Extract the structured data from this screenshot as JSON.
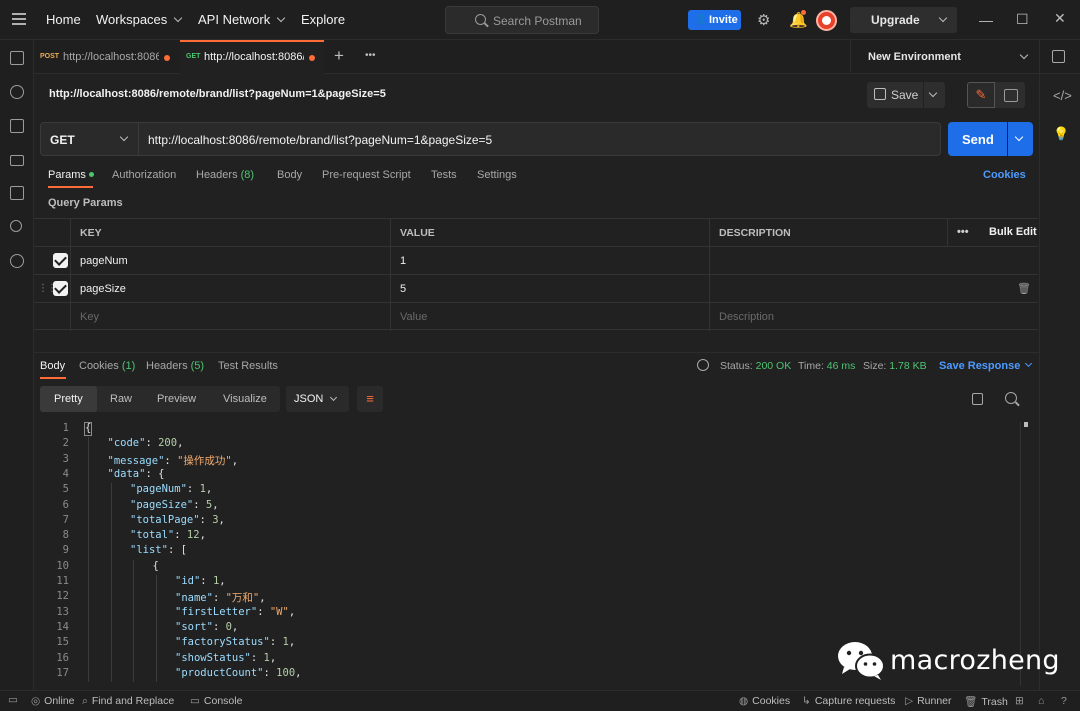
{
  "topbar": {
    "nav": [
      "Home",
      "Workspaces",
      "API Network",
      "Explore"
    ],
    "search_placeholder": "Search Postman",
    "invite_label": "Invite",
    "upgrade_label": "Upgrade"
  },
  "tabs": [
    {
      "method": "POST",
      "title": "http://localhost:8086/",
      "active": false,
      "method_color": "#f0ad4e"
    },
    {
      "method": "GET",
      "title": "http://localhost:8086/r",
      "active": true,
      "method_color": "#4bc570"
    }
  ],
  "environment": "New Environment",
  "request": {
    "name": "http://localhost:8086/remote/brand/list?pageNum=1&pageSize=5",
    "save_label": "Save",
    "method": "GET",
    "url": "http://localhost:8086/remote/brand/list?pageNum=1&pageSize=5",
    "send_label": "Send"
  },
  "request_tabs": {
    "params": "Params",
    "authorization": "Authorization",
    "headers": "Headers",
    "headers_count": "(8)",
    "body": "Body",
    "prerequest": "Pre-request Script",
    "tests": "Tests",
    "settings": "Settings",
    "cookies": "Cookies"
  },
  "query_params": {
    "label": "Query Params",
    "headers": {
      "key": "KEY",
      "value": "VALUE",
      "description": "DESCRIPTION",
      "bulk_edit": "Bulk Edit",
      "more": "•••"
    },
    "rows": [
      {
        "key": "pageNum",
        "value": "1"
      },
      {
        "key": "pageSize",
        "value": "5"
      }
    ],
    "placeholders": {
      "key": "Key",
      "value": "Value",
      "description": "Description"
    }
  },
  "response": {
    "tabs": {
      "body": "Body",
      "cookies": "Cookies",
      "cookies_count": "(1)",
      "headers": "Headers",
      "headers_count": "(5)",
      "test_results": "Test Results"
    },
    "status_label": "Status:",
    "status_value": "200 OK",
    "time_label": "Time:",
    "time_value": "46 ms",
    "size_label": "Size:",
    "size_value": "1.78 KB",
    "save_response": "Save Response",
    "view_tabs": [
      "Pretty",
      "Raw",
      "Preview",
      "Visualize"
    ],
    "format": "JSON"
  },
  "code_lines": [
    {
      "n": "1",
      "indent": 0,
      "html": "{"
    },
    {
      "n": "2",
      "indent": 1,
      "html": "<span class='k'>\"code\"</span>: <span class='n'>200</span>,"
    },
    {
      "n": "3",
      "indent": 1,
      "html": "<span class='k'>\"message\"</span>: <span class='s'>\"操作成功\"</span>,"
    },
    {
      "n": "4",
      "indent": 1,
      "html": "<span class='k'>\"data\"</span>: {"
    },
    {
      "n": "5",
      "indent": 2,
      "html": "<span class='k'>\"pageNum\"</span>: <span class='n'>1</span>,"
    },
    {
      "n": "6",
      "indent": 2,
      "html": "<span class='k'>\"pageSize\"</span>: <span class='n'>5</span>,"
    },
    {
      "n": "7",
      "indent": 2,
      "html": "<span class='k'>\"totalPage\"</span>: <span class='n'>3</span>,"
    },
    {
      "n": "8",
      "indent": 2,
      "html": "<span class='k'>\"total\"</span>: <span class='n'>12</span>,"
    },
    {
      "n": "9",
      "indent": 2,
      "html": "<span class='k'>\"list\"</span>: ["
    },
    {
      "n": "10",
      "indent": 3,
      "html": "{"
    },
    {
      "n": "11",
      "indent": 4,
      "html": "<span class='k'>\"id\"</span>: <span class='n'>1</span>,"
    },
    {
      "n": "12",
      "indent": 4,
      "html": "<span class='k'>\"name\"</span>: <span class='s'>\"万和\"</span>,"
    },
    {
      "n": "13",
      "indent": 4,
      "html": "<span class='k'>\"firstLetter\"</span>: <span class='s'>\"W\"</span>,"
    },
    {
      "n": "14",
      "indent": 4,
      "html": "<span class='k'>\"sort\"</span>: <span class='n'>0</span>,"
    },
    {
      "n": "15",
      "indent": 4,
      "html": "<span class='k'>\"factoryStatus\"</span>: <span class='n'>1</span>,"
    },
    {
      "n": "16",
      "indent": 4,
      "html": "<span class='k'>\"showStatus\"</span>: <span class='n'>1</span>,"
    },
    {
      "n": "17",
      "indent": 4,
      "html": "<span class='k'>\"productCount\"</span>: <span class='n'>100</span>,"
    }
  ],
  "watermark": "macrozheng",
  "statusbar": {
    "online": "Online",
    "find_replace": "Find and Replace",
    "console": "Console",
    "cookies": "Cookies",
    "capture": "Capture requests",
    "runner": "Runner",
    "trash": "Trash"
  }
}
